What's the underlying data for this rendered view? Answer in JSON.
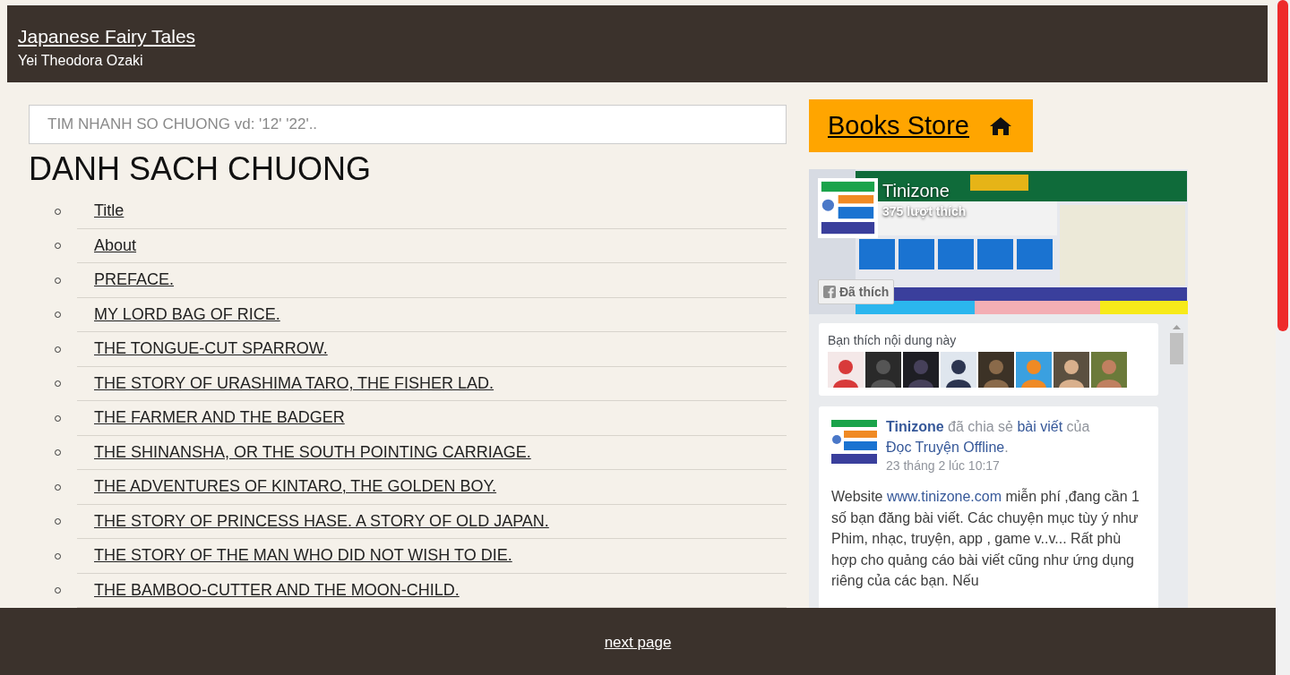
{
  "header": {
    "title": "Japanese Fairy Tales",
    "author": "Yei Theodora Ozaki"
  },
  "search": {
    "placeholder": "TIM NHANH SO CHUONG vd: '12' '22'.."
  },
  "chapter_list": {
    "heading": "DANH SACH CHUONG",
    "items": [
      "Title",
      "About",
      "PREFACE.",
      "MY LORD BAG OF RICE.",
      "THE TONGUE-CUT SPARROW.",
      "THE STORY OF URASHIMA TARO, THE FISHER LAD.",
      "THE FARMER AND THE BADGER",
      "THE SHINANSHA, OR THE SOUTH POINTING CARRIAGE.",
      "THE ADVENTURES OF KINTARO, THE GOLDEN BOY.",
      "THE STORY OF PRINCESS HASE. A STORY OF OLD JAPAN.",
      "THE STORY OF THE MAN WHO DID NOT WISH TO DIE.",
      "THE BAMBOO-CUTTER AND THE MOON-CHILD."
    ]
  },
  "store_button": {
    "label": "Books Store"
  },
  "facebook_widget": {
    "page_name": "Tinizone",
    "likes": "375 lượt thích",
    "like_button": "Đã thích",
    "liked_by": {
      "label": "Bạn thích nội dung này"
    },
    "post": {
      "headline": [
        {
          "kind": "name",
          "text": "Tinizone"
        },
        {
          "kind": "plain",
          "text": "đã chia sẻ"
        },
        {
          "kind": "link",
          "text": "bài viết"
        },
        {
          "kind": "plain",
          "text": "của"
        },
        {
          "kind": "link",
          "text": "Đọc Truyện Offline"
        },
        {
          "kind": "plain",
          "text": "."
        }
      ],
      "date": "23 tháng 2 lúc 10:17",
      "body": [
        {
          "kind": "plain",
          "text": "Website"
        },
        {
          "kind": "link",
          "text": "www.tinizone.com"
        },
        {
          "kind": "plain",
          "text": "miễn phí ,đang cần 1 số bạn đăng bài viết. Các chuyện mục tùy ý như Phim, nhạc, truyện, app , game v..v... Rất phù hợp cho quảng cáo bài viết cũng như ứng dụng riêng của các bạn. Nếu"
        }
      ]
    }
  },
  "footer": {
    "next_link": "next page"
  }
}
